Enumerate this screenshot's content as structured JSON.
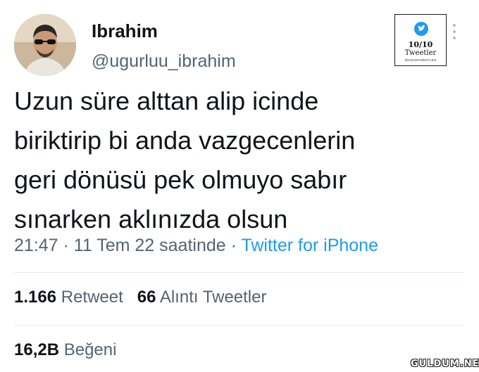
{
  "author": {
    "display_name": "Ibrahim",
    "handle": "@ugurluu_ibrahim",
    "avatar_icon": "profile-photo"
  },
  "badge": {
    "icon": "twitter-bird-icon",
    "score": "10/10",
    "kind": "Tweetler",
    "credit": "@ONONTWEETLER"
  },
  "tweet": {
    "lines": [
      "Uzun süre alttan alip icinde",
      "biriktirip bi anda vazgecenlerin",
      "geri dönüsü pek olmuyo sabır",
      "sınarken aklınızda olsun"
    ],
    "time": "21:47",
    "date": "11 Tem 22 saatinde",
    "separator": " · ",
    "source": "Twitter for iPhone"
  },
  "stats": {
    "retweets_count": "1.166",
    "retweets_label": "Retweet",
    "quotes_count": "66",
    "quotes_label": "Alıntı Tweetler",
    "likes_count": "16,2B",
    "likes_label": "Beğeni"
  },
  "watermark": "GULDUM.NET",
  "colors": {
    "text": "#0f1419",
    "secondary": "#536471",
    "link": "#1d9bf0",
    "divider": "#e6ebee"
  }
}
